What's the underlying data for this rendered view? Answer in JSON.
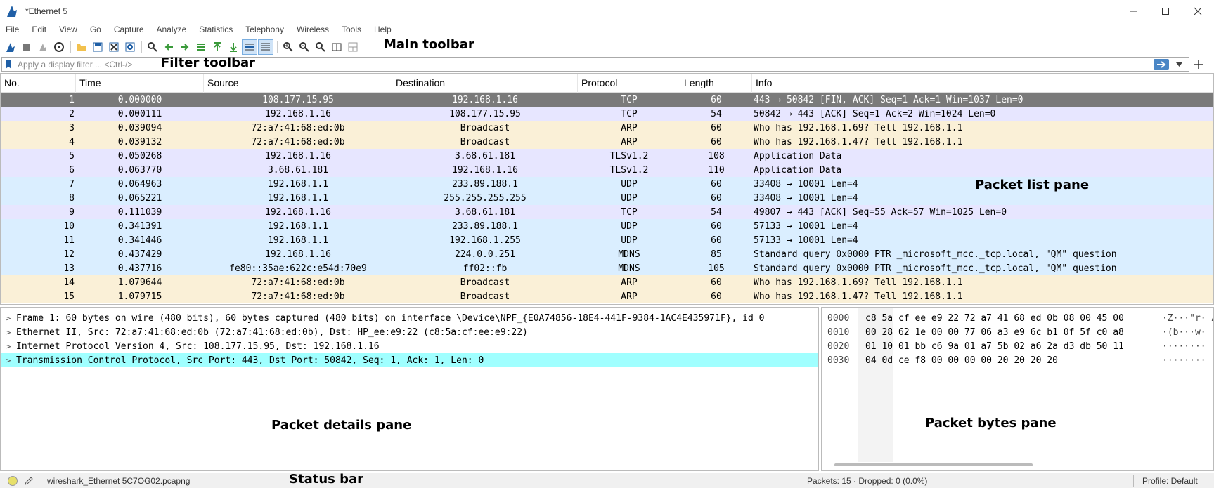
{
  "window": {
    "title": "*Ethernet 5",
    "controls": [
      "minimize",
      "maximize",
      "close"
    ]
  },
  "menu": [
    "File",
    "Edit",
    "View",
    "Go",
    "Capture",
    "Analyze",
    "Statistics",
    "Telephony",
    "Wireless",
    "Tools",
    "Help"
  ],
  "toolbar_icons": [
    "shark-fin-start-icon",
    "stop-icon",
    "restart-icon",
    "options-gear-icon",
    "open-folder-icon",
    "file-save-icon",
    "close-file-icon",
    "reload-icon",
    "find-icon",
    "back-arrow-icon",
    "forward-arrow-icon",
    "goto-packet-icon",
    "first-packet-icon",
    "last-packet-icon",
    "autoscroll-icon",
    "colorize-icon",
    "zoom-in-icon",
    "zoom-out-icon",
    "zoom-reset-icon",
    "resize-columns-icon",
    "layout-icon"
  ],
  "annotations": {
    "main_toolbar": "Main toolbar",
    "filter_toolbar": "Filter toolbar",
    "packet_list": "Packet list pane",
    "packet_details": "Packet details pane",
    "packet_bytes": "Packet bytes pane",
    "status_bar": "Status bar"
  },
  "filter": {
    "placeholder": "Apply a display filter ... <Ctrl-/>",
    "value": ""
  },
  "packet_list": {
    "columns": [
      "No.",
      "Time",
      "Source",
      "Destination",
      "Protocol",
      "Length",
      "Info"
    ],
    "rows": [
      {
        "no": "1",
        "time": "0.000000",
        "src": "108.177.15.95",
        "dst": "192.168.1.16",
        "proto": "TCP",
        "len": "60",
        "info": "443 → 50842 [FIN, ACK] Seq=1 Ack=1 Win=1037 Len=0",
        "color": "selected"
      },
      {
        "no": "2",
        "time": "0.000111",
        "src": "192.168.1.16",
        "dst": "108.177.15.95",
        "proto": "TCP",
        "len": "54",
        "info": "50842 → 443 [ACK] Seq=1 Ack=2 Win=1024 Len=0",
        "color": "tcp"
      },
      {
        "no": "3",
        "time": "0.039094",
        "src": "72:a7:41:68:ed:0b",
        "dst": "Broadcast",
        "proto": "ARP",
        "len": "60",
        "info": "Who has 192.168.1.69? Tell 192.168.1.1",
        "color": "arp"
      },
      {
        "no": "4",
        "time": "0.039132",
        "src": "72:a7:41:68:ed:0b",
        "dst": "Broadcast",
        "proto": "ARP",
        "len": "60",
        "info": "Who has 192.168.1.47? Tell 192.168.1.1",
        "color": "arp"
      },
      {
        "no": "5",
        "time": "0.050268",
        "src": "192.168.1.16",
        "dst": "3.68.61.181",
        "proto": "TLSv1.2",
        "len": "108",
        "info": "Application Data",
        "color": "tcp"
      },
      {
        "no": "6",
        "time": "0.063770",
        "src": "3.68.61.181",
        "dst": "192.168.1.16",
        "proto": "TLSv1.2",
        "len": "110",
        "info": "Application Data",
        "color": "tcp"
      },
      {
        "no": "7",
        "time": "0.064963",
        "src": "192.168.1.1",
        "dst": "233.89.188.1",
        "proto": "UDP",
        "len": "60",
        "info": "33408 → 10001 Len=4",
        "color": "udp"
      },
      {
        "no": "8",
        "time": "0.065221",
        "src": "192.168.1.1",
        "dst": "255.255.255.255",
        "proto": "UDP",
        "len": "60",
        "info": "33408 → 10001 Len=4",
        "color": "udp"
      },
      {
        "no": "9",
        "time": "0.111039",
        "src": "192.168.1.16",
        "dst": "3.68.61.181",
        "proto": "TCP",
        "len": "54",
        "info": "49807 → 443 [ACK] Seq=55 Ack=57 Win=1025 Len=0",
        "color": "tcp"
      },
      {
        "no": "10",
        "time": "0.341391",
        "src": "192.168.1.1",
        "dst": "233.89.188.1",
        "proto": "UDP",
        "len": "60",
        "info": "57133 → 10001 Len=4",
        "color": "udp"
      },
      {
        "no": "11",
        "time": "0.341446",
        "src": "192.168.1.1",
        "dst": "192.168.1.255",
        "proto": "UDP",
        "len": "60",
        "info": "57133 → 10001 Len=4",
        "color": "udp"
      },
      {
        "no": "12",
        "time": "0.437429",
        "src": "192.168.1.16",
        "dst": "224.0.0.251",
        "proto": "MDNS",
        "len": "85",
        "info": "Standard query 0x0000 PTR _microsoft_mcc._tcp.local, \"QM\" question",
        "color": "udp"
      },
      {
        "no": "13",
        "time": "0.437716",
        "src": "fe80::35ae:622c:e54d:70e9",
        "dst": "ff02::fb",
        "proto": "MDNS",
        "len": "105",
        "info": "Standard query 0x0000 PTR _microsoft_mcc._tcp.local, \"QM\" question",
        "color": "udp"
      },
      {
        "no": "14",
        "time": "1.079644",
        "src": "72:a7:41:68:ed:0b",
        "dst": "Broadcast",
        "proto": "ARP",
        "len": "60",
        "info": "Who has 192.168.1.69? Tell 192.168.1.1",
        "color": "arp"
      },
      {
        "no": "15",
        "time": "1.079715",
        "src": "72:a7:41:68:ed:0b",
        "dst": "Broadcast",
        "proto": "ARP",
        "len": "60",
        "info": "Who has 192.168.1.47? Tell 192.168.1.1",
        "color": "arp"
      }
    ]
  },
  "packet_details": [
    {
      "text": "Frame 1: 60 bytes on wire (480 bits), 60 bytes captured (480 bits) on interface \\Device\\NPF_{E0A74856-18E4-441F-9384-1AC4E435971F}, id 0",
      "highlight": false
    },
    {
      "text": "Ethernet II, Src: 72:a7:41:68:ed:0b (72:a7:41:68:ed:0b), Dst: HP_ee:e9:22 (c8:5a:cf:ee:e9:22)",
      "highlight": false
    },
    {
      "text": "Internet Protocol Version 4, Src: 108.177.15.95, Dst: 192.168.1.16",
      "highlight": false
    },
    {
      "text": "Transmission Control Protocol, Src Port: 443, Dst Port: 50842, Seq: 1, Ack: 1, Len: 0",
      "highlight": true
    }
  ],
  "packet_bytes": [
    {
      "offset": "0000",
      "hex": "c8 5a cf ee e9 22 72 a7  41 68 ed 0b 08 00 45 00",
      "ascii": "·Z···\"r· A"
    },
    {
      "offset": "0010",
      "hex": "00 28 62 1e 00 00 77 06  a3 e9 6c b1 0f 5f c0 a8",
      "ascii": "·(b···w·"
    },
    {
      "offset": "0020",
      "hex": "01 10 01 bb c6 9a 01 a7  5b 02 a6 2a d3 db 50 11",
      "ascii": "········"
    },
    {
      "offset": "0030",
      "hex": "04 0d ce f8 00 00 00 00  20 20 20 20",
      "ascii": "········"
    }
  ],
  "status": {
    "file": "wireshark_Ethernet 5C7OG02.pcapng",
    "packets": "Packets: 15 · Dropped: 0 (0.0%)",
    "profile": "Profile: Default"
  },
  "colors": {
    "selected_row": "#7a7a7a",
    "tcp_row": "#e7e6ff",
    "arp_row": "#faf0d7",
    "udp_row": "#daeeff",
    "detail_highlight": "#a0ffff"
  }
}
